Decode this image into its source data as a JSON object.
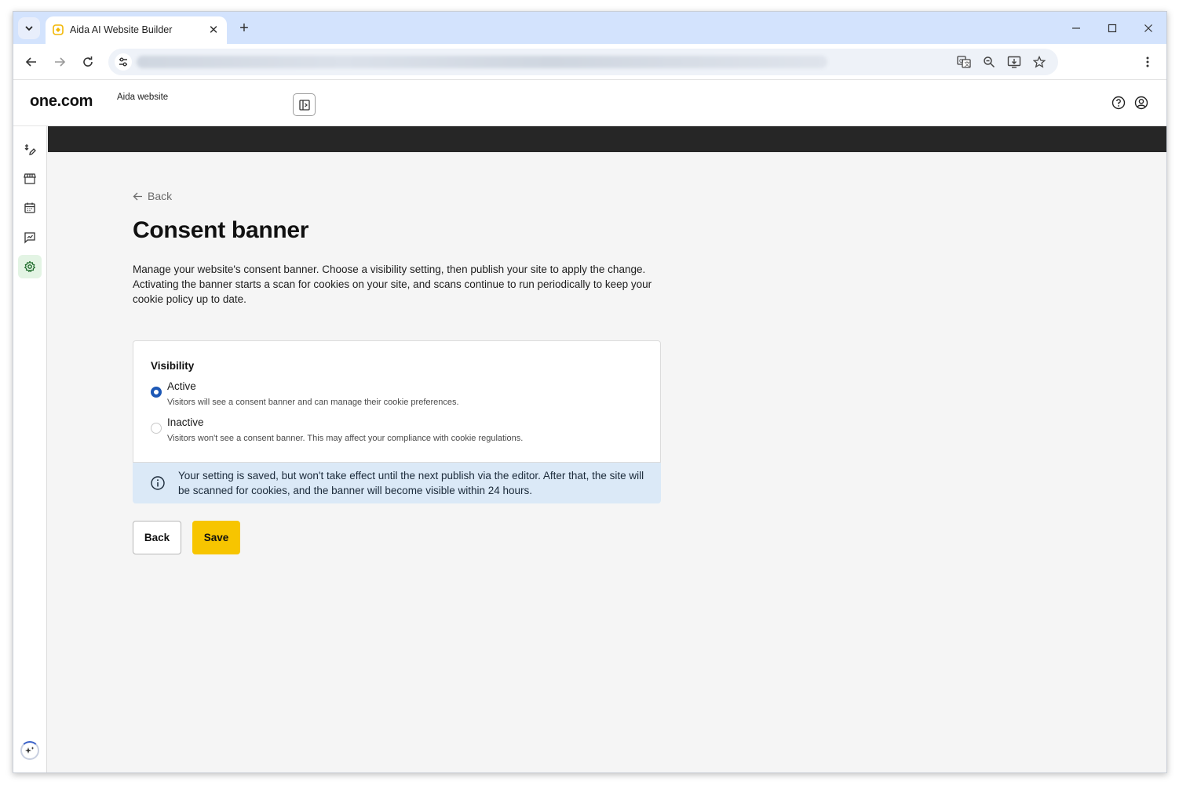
{
  "browser": {
    "tab_title": "Aida AI Website Builder",
    "new_tab": "+",
    "close_tab": "✕"
  },
  "header": {
    "logo": "one.com",
    "site_name": "Aida website"
  },
  "sidebar": {
    "items": [
      {
        "name": "edit",
        "icon": "edit-icon",
        "active": false
      },
      {
        "name": "store",
        "icon": "store-icon",
        "active": false
      },
      {
        "name": "calendar",
        "icon": "calendar-icon",
        "active": false
      },
      {
        "name": "analytics",
        "icon": "analytics-icon",
        "active": false
      },
      {
        "name": "settings",
        "icon": "gear-icon",
        "active": true
      }
    ],
    "accent": "#e3f4e4"
  },
  "page": {
    "back_link": "Back",
    "title": "Consent banner",
    "description": "Manage your website's consent banner. Choose a visibility setting, then publish your site to apply the change. Activating the banner starts a scan for cookies on your site, and scans continue to run periodically to keep your cookie policy up to date.",
    "visibility": {
      "label": "Visibility",
      "options": [
        {
          "title": "Active",
          "subtitle": "Visitors will see a consent banner and can manage their cookie preferences.",
          "checked": true
        },
        {
          "title": "Inactive",
          "subtitle": "Visitors won't see a consent banner. This may affect your compliance with cookie regulations.",
          "checked": false
        }
      ]
    },
    "info_text": "Your setting is saved, but won't take effect until the next publish via the editor. After that, the site will be scanned for cookies, and the banner will become visible within 24 hours.",
    "buttons": {
      "back": "Back",
      "save": "Save"
    }
  },
  "colors": {
    "save_button": "#f7c500",
    "radio_checked": "#1d58b6",
    "info_background": "#dbe9f7",
    "dark_bar": "#262626"
  }
}
